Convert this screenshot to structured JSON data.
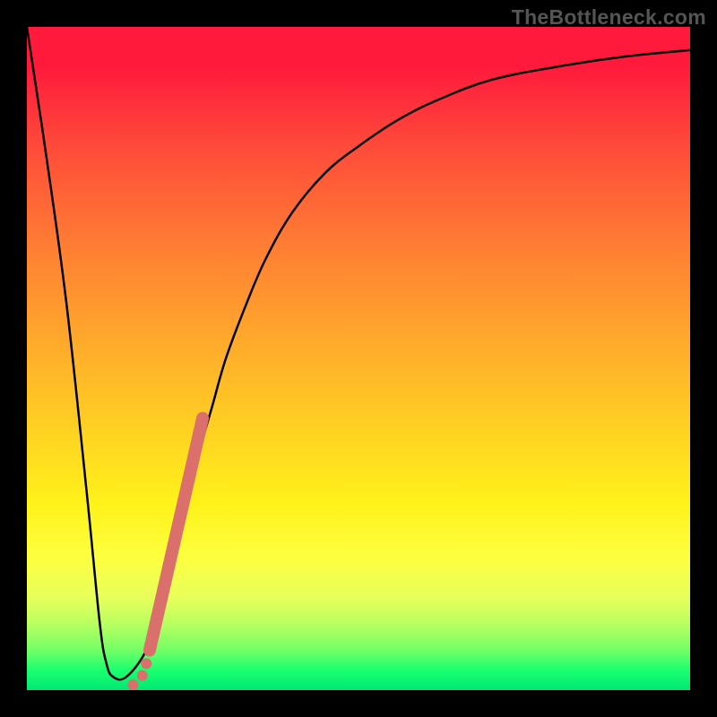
{
  "watermark": "TheBottleneck.com",
  "chart_data": {
    "type": "line",
    "title": "",
    "xlabel": "",
    "ylabel": "",
    "xlim": [
      0,
      100
    ],
    "ylim": [
      0,
      100
    ],
    "grid": false,
    "legend": false,
    "background_gradient": {
      "direction": "vertical",
      "stops": [
        {
          "pos": 0.0,
          "color": "#ff1a3c"
        },
        {
          "pos": 0.18,
          "color": "#ff4a3a"
        },
        {
          "pos": 0.32,
          "color": "#ff7a34"
        },
        {
          "pos": 0.46,
          "color": "#ffa52c"
        },
        {
          "pos": 0.6,
          "color": "#ffcf23"
        },
        {
          "pos": 0.72,
          "color": "#fff21a"
        },
        {
          "pos": 0.86,
          "color": "#e8ff5a"
        },
        {
          "pos": 0.94,
          "color": "#72ff66"
        },
        {
          "pos": 1.0,
          "color": "#00e874"
        }
      ]
    },
    "series": [
      {
        "name": "bottleneck-curve",
        "color": "#000000",
        "x": [
          0,
          3,
          6,
          9,
          11,
          12,
          13,
          15,
          18,
          20,
          22,
          24,
          26,
          28,
          30,
          33,
          36,
          40,
          45,
          50,
          56,
          62,
          70,
          80,
          90,
          100
        ],
        "y": [
          100,
          80,
          58,
          30,
          10,
          4,
          2,
          2,
          6,
          12,
          20,
          28,
          36,
          43,
          50,
          58,
          65,
          72,
          78,
          82,
          86,
          89,
          92,
          94,
          95.5,
          96.5
        ]
      }
    ],
    "markers": {
      "line_segment": {
        "x0": 18.5,
        "y0": 6,
        "x1": 26.5,
        "y1": 41,
        "color": "#db6f6b"
      },
      "dots": [
        {
          "x": 18.0,
          "y": 4.0
        },
        {
          "x": 17.4,
          "y": 2.2
        },
        {
          "x": 16.0,
          "y": 0.8
        }
      ]
    }
  }
}
